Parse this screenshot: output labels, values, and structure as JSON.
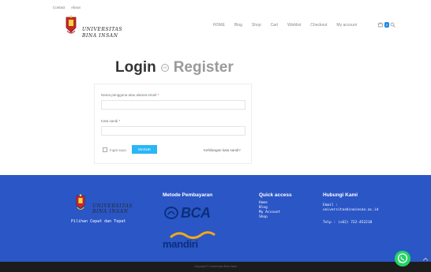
{
  "topbar": {
    "contact_label": "Contact",
    "about_label": "About"
  },
  "header": {
    "logo_line1": "UNIVERSITAS",
    "logo_line2": "BINA INSAN",
    "nav": [
      {
        "label": "HOME"
      },
      {
        "label": "Blog"
      },
      {
        "label": "Shop"
      },
      {
        "label": "Cart"
      },
      {
        "label": "Wishlist"
      },
      {
        "label": "Checkout"
      },
      {
        "label": "My account"
      }
    ],
    "cart_count": "0"
  },
  "page": {
    "login_title": "Login",
    "or_label": "OR",
    "register_title": "Register"
  },
  "login_form": {
    "username_label": "Nama pengguna atau alamat email",
    "username_value": "",
    "password_label": "Kata sandi",
    "password_value": "",
    "required_mark": "*",
    "remember_label": "Ingat saya",
    "login_button": "MASUK",
    "lost_password": "Kehilangan kata sandi?"
  },
  "footer": {
    "logo_line1": "UNIVERSITAS",
    "logo_line2": "BINA INSAN",
    "tagline": "Pilihan Cepat dan Tepat",
    "payment_title": "Metode Pembayaran",
    "payment_methods": [
      "BCA",
      "mandiri"
    ],
    "quick_access_title": "Quick access",
    "quick_access": [
      {
        "label": "Home"
      },
      {
        "label": "Blog"
      },
      {
        "label": "My Account"
      },
      {
        "label": "Shop"
      }
    ],
    "contact_title": "Hubungi Kami",
    "email_label": "Email :",
    "email": "universitasbinainsan.ac.id",
    "phone": "Telp : (+62) 722-452218",
    "copyright": "Copyright © Universitas Bina Insan"
  },
  "colors": {
    "footer_bg": "#2a56c6",
    "button_blue": "#29b6f6",
    "cart_badge": "#1e88e5",
    "whatsapp": "#25d366"
  },
  "icons": {
    "cart": "cart-icon",
    "search": "search-icon",
    "whatsapp": "whatsapp-icon",
    "scroll_up": "chevron-up-icon"
  }
}
